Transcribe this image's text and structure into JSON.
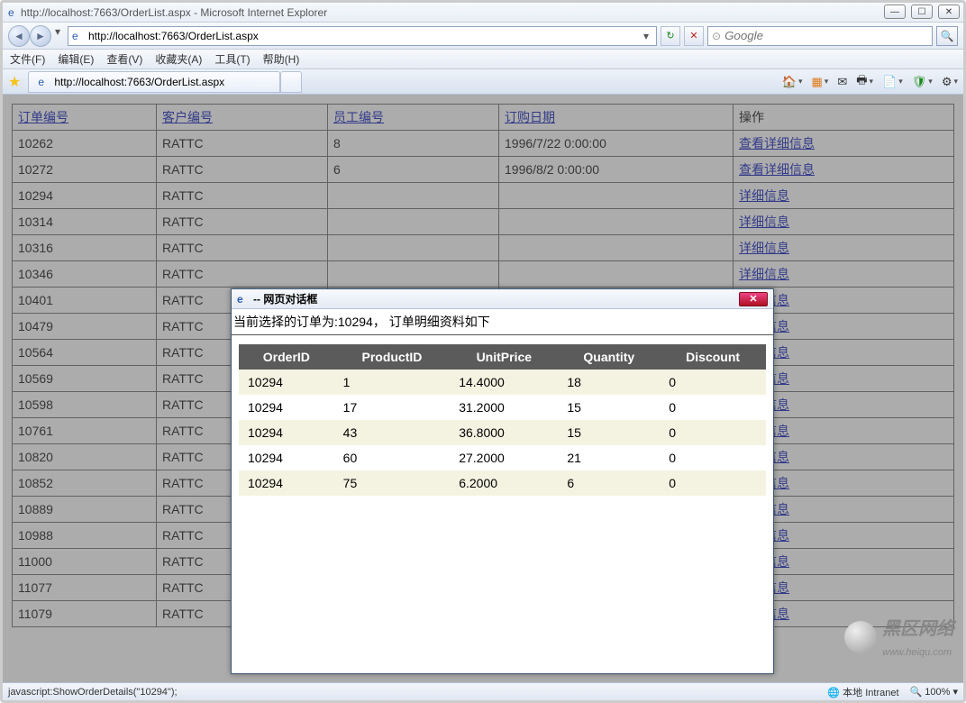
{
  "window": {
    "title": "http://localhost:7663/OrderList.aspx - Microsoft Internet Explorer",
    "url": "http://localhost:7663/OrderList.aspx",
    "tab_title": "http://localhost:7663/OrderList.aspx",
    "search_placeholder": "Google"
  },
  "winbuttons": {
    "min": "—",
    "max": "☐",
    "close": "✕"
  },
  "menus": {
    "file": "文件(F)",
    "edit": "编辑(E)",
    "view": "查看(V)",
    "favorites": "收藏夹(A)",
    "tools": "工具(T)",
    "help": "帮助(H)"
  },
  "orders": {
    "headers": {
      "order_id": "订单编号",
      "customer_id": "客户编号",
      "employee_id": "员工编号",
      "order_date": "订购日期",
      "action": "操作"
    },
    "action_label": "查看详细信息",
    "partial_action_label": "详细信息",
    "rows": [
      {
        "order_id": "10262",
        "customer_id": "RATTC",
        "employee_id": "8",
        "order_date": "1996/7/22 0:00:00"
      },
      {
        "order_id": "10272",
        "customer_id": "RATTC",
        "employee_id": "6",
        "order_date": "1996/8/2 0:00:00"
      },
      {
        "order_id": "10294",
        "customer_id": "RATTC",
        "employee_id": "",
        "order_date": ""
      },
      {
        "order_id": "10314",
        "customer_id": "RATTC",
        "employee_id": "",
        "order_date": ""
      },
      {
        "order_id": "10316",
        "customer_id": "RATTC",
        "employee_id": "",
        "order_date": ""
      },
      {
        "order_id": "10346",
        "customer_id": "RATTC",
        "employee_id": "",
        "order_date": ""
      },
      {
        "order_id": "10401",
        "customer_id": "RATTC",
        "employee_id": "",
        "order_date": ""
      },
      {
        "order_id": "10479",
        "customer_id": "RATTC",
        "employee_id": "",
        "order_date": ""
      },
      {
        "order_id": "10564",
        "customer_id": "RATTC",
        "employee_id": "",
        "order_date": ""
      },
      {
        "order_id": "10569",
        "customer_id": "RATTC",
        "employee_id": "",
        "order_date": ""
      },
      {
        "order_id": "10598",
        "customer_id": "RATTC",
        "employee_id": "",
        "order_date": ""
      },
      {
        "order_id": "10761",
        "customer_id": "RATTC",
        "employee_id": "",
        "order_date": ""
      },
      {
        "order_id": "10820",
        "customer_id": "RATTC",
        "employee_id": "",
        "order_date": ""
      },
      {
        "order_id": "10852",
        "customer_id": "RATTC",
        "employee_id": "",
        "order_date": ""
      },
      {
        "order_id": "10889",
        "customer_id": "RATTC",
        "employee_id": "",
        "order_date": ""
      },
      {
        "order_id": "10988",
        "customer_id": "RATTC",
        "employee_id": "",
        "order_date": ""
      },
      {
        "order_id": "11000",
        "customer_id": "RATTC",
        "employee_id": "",
        "order_date": ""
      },
      {
        "order_id": "11077",
        "customer_id": "RATTC",
        "employee_id": "",
        "order_date": ""
      },
      {
        "order_id": "11079",
        "customer_id": "RATTC",
        "employee_id": "",
        "order_date": ""
      }
    ]
  },
  "dialog": {
    "title": " -- 网页对话框",
    "subtitle": "当前选择的订单为:10294， 订单明细资料如下",
    "headers": {
      "order_id": "OrderID",
      "product_id": "ProductID",
      "unit_price": "UnitPrice",
      "quantity": "Quantity",
      "discount": "Discount"
    },
    "rows": [
      {
        "order_id": "10294",
        "product_id": "1",
        "unit_price": "14.4000",
        "quantity": "18",
        "discount": "0"
      },
      {
        "order_id": "10294",
        "product_id": "17",
        "unit_price": "31.2000",
        "quantity": "15",
        "discount": "0"
      },
      {
        "order_id": "10294",
        "product_id": "43",
        "unit_price": "36.8000",
        "quantity": "15",
        "discount": "0"
      },
      {
        "order_id": "10294",
        "product_id": "60",
        "unit_price": "27.2000",
        "quantity": "21",
        "discount": "0"
      },
      {
        "order_id": "10294",
        "product_id": "75",
        "unit_price": "6.2000",
        "quantity": "6",
        "discount": "0"
      }
    ]
  },
  "status": {
    "left": "javascript:ShowOrderDetails(\"10294\");",
    "zone": "本地 Intranet",
    "zoom": "100%"
  },
  "watermark": {
    "brand": "黑区网络",
    "sub": "www.heiqu.com"
  }
}
